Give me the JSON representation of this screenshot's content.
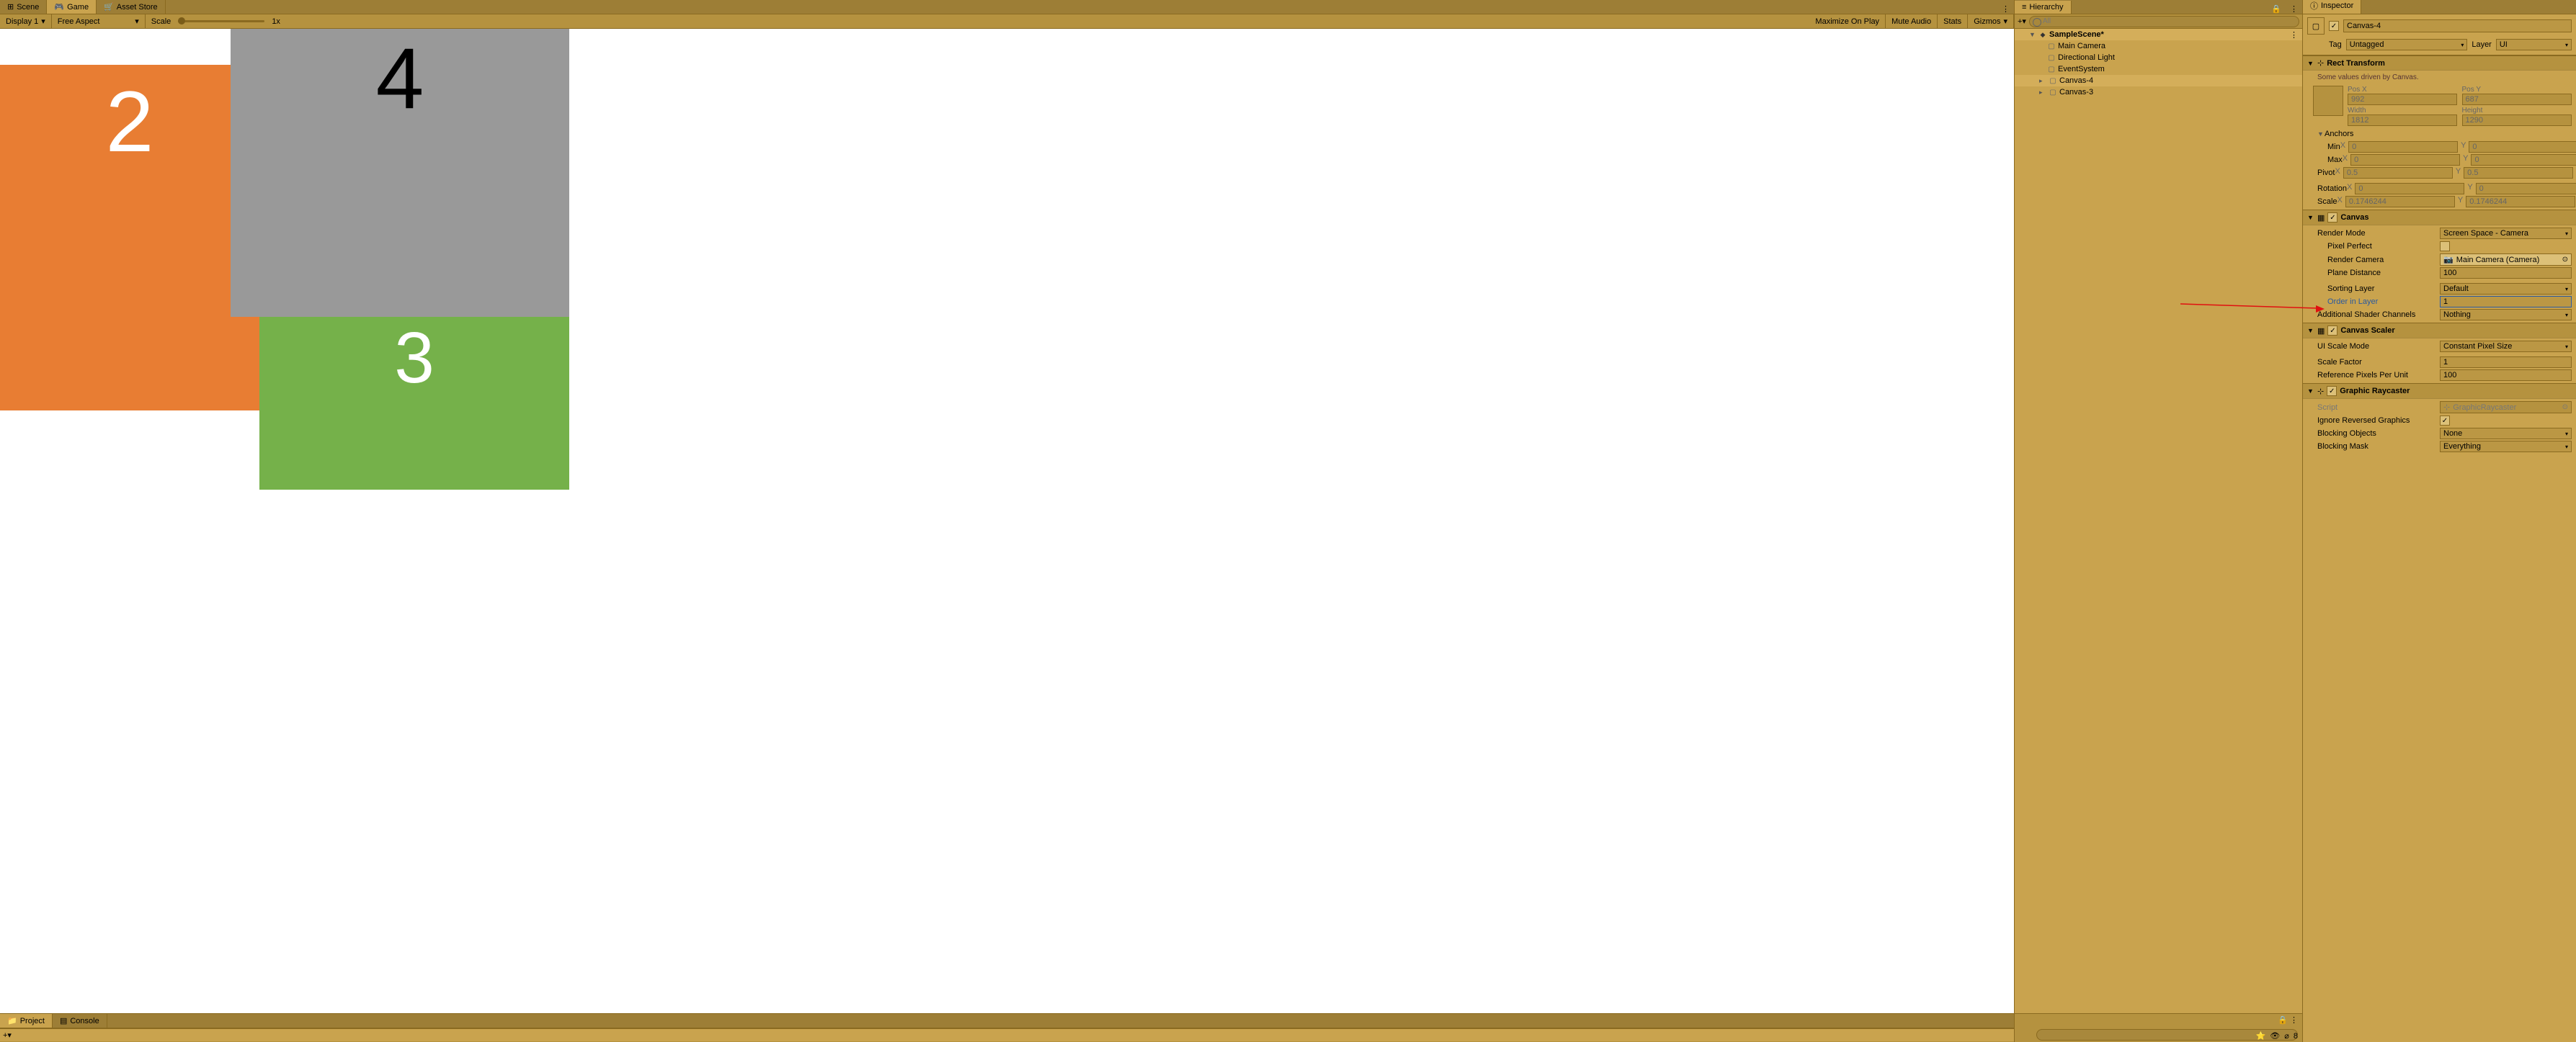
{
  "gamePanel": {
    "tabs": {
      "scene": "Scene",
      "game": "Game",
      "assetStore": "Asset Store"
    },
    "toolbar": {
      "display": "Display 1",
      "aspect": "Free Aspect",
      "scaleLabel": "Scale",
      "scaleValue": "1x",
      "maximize": "Maximize On Play",
      "muteAudio": "Mute Audio",
      "stats": "Stats",
      "gizmos": "Gizmos"
    },
    "boxes": {
      "b2": "2",
      "b3": "3",
      "b4": "4"
    }
  },
  "bottom": {
    "project": "Project",
    "console": "Console",
    "footerCount": "8"
  },
  "hierarchy": {
    "title": "Hierarchy",
    "searchPlaceholder": "All",
    "tree": {
      "scene": "SampleScene*",
      "mainCamera": "Main Camera",
      "dirLight": "Directional Light",
      "eventSystem": "EventSystem",
      "canvas4": "Canvas-4",
      "canvas3": "Canvas-3"
    }
  },
  "inspector": {
    "title": "Inspector",
    "objectName": "Canvas-4",
    "tagLabel": "Tag",
    "tagValue": "Untagged",
    "layerLabel": "Layer",
    "layerValue": "UI",
    "rectTransform": {
      "title": "Rect Transform",
      "info": "Some values driven by Canvas.",
      "posX": {
        "label": "Pos X",
        "value": "992"
      },
      "posY": {
        "label": "Pos Y",
        "value": "687"
      },
      "width": {
        "label": "Width",
        "value": "1812"
      },
      "height": {
        "label": "Height",
        "value": "1290"
      },
      "anchorsLabel": "Anchors",
      "min": {
        "label": "Min",
        "x": "0",
        "y": "0"
      },
      "max": {
        "label": "Max",
        "x": "0",
        "y": "0"
      },
      "pivot": {
        "label": "Pivot",
        "x": "0.5",
        "y": "0.5"
      },
      "rotation": {
        "label": "Rotation",
        "x": "0",
        "y": "0"
      },
      "scale": {
        "label": "Scale",
        "x": "0.1746244",
        "y": "0.1746244"
      }
    },
    "canvas": {
      "title": "Canvas",
      "renderMode": {
        "label": "Render Mode",
        "value": "Screen Space - Camera"
      },
      "pixelPerfect": "Pixel Perfect",
      "renderCamera": {
        "label": "Render Camera",
        "value": "Main Camera (Camera)"
      },
      "planeDistance": {
        "label": "Plane Distance",
        "value": "100"
      },
      "sortingLayer": {
        "label": "Sorting Layer",
        "value": "Default"
      },
      "orderInLayer": {
        "label": "Order in Layer",
        "value": "1"
      },
      "additionalShaderChannels": {
        "label": "Additional Shader Channels",
        "value": "Nothing"
      }
    },
    "canvasScaler": {
      "title": "Canvas Scaler",
      "uiScaleMode": {
        "label": "UI Scale Mode",
        "value": "Constant Pixel Size"
      },
      "scaleFactor": {
        "label": "Scale Factor",
        "value": "1"
      },
      "refPixels": {
        "label": "Reference Pixels Per Unit",
        "value": "100"
      }
    },
    "graphicRaycaster": {
      "title": "Graphic Raycaster",
      "script": {
        "label": "Script",
        "value": "GraphicRaycaster"
      },
      "ignoreReversed": "Ignore Reversed Graphics",
      "blockingObjects": {
        "label": "Blocking Objects",
        "value": "None"
      },
      "blockingMask": {
        "label": "Blocking Mask",
        "value": "Everything"
      }
    }
  },
  "xyLabels": {
    "x": "X",
    "y": "Y"
  }
}
